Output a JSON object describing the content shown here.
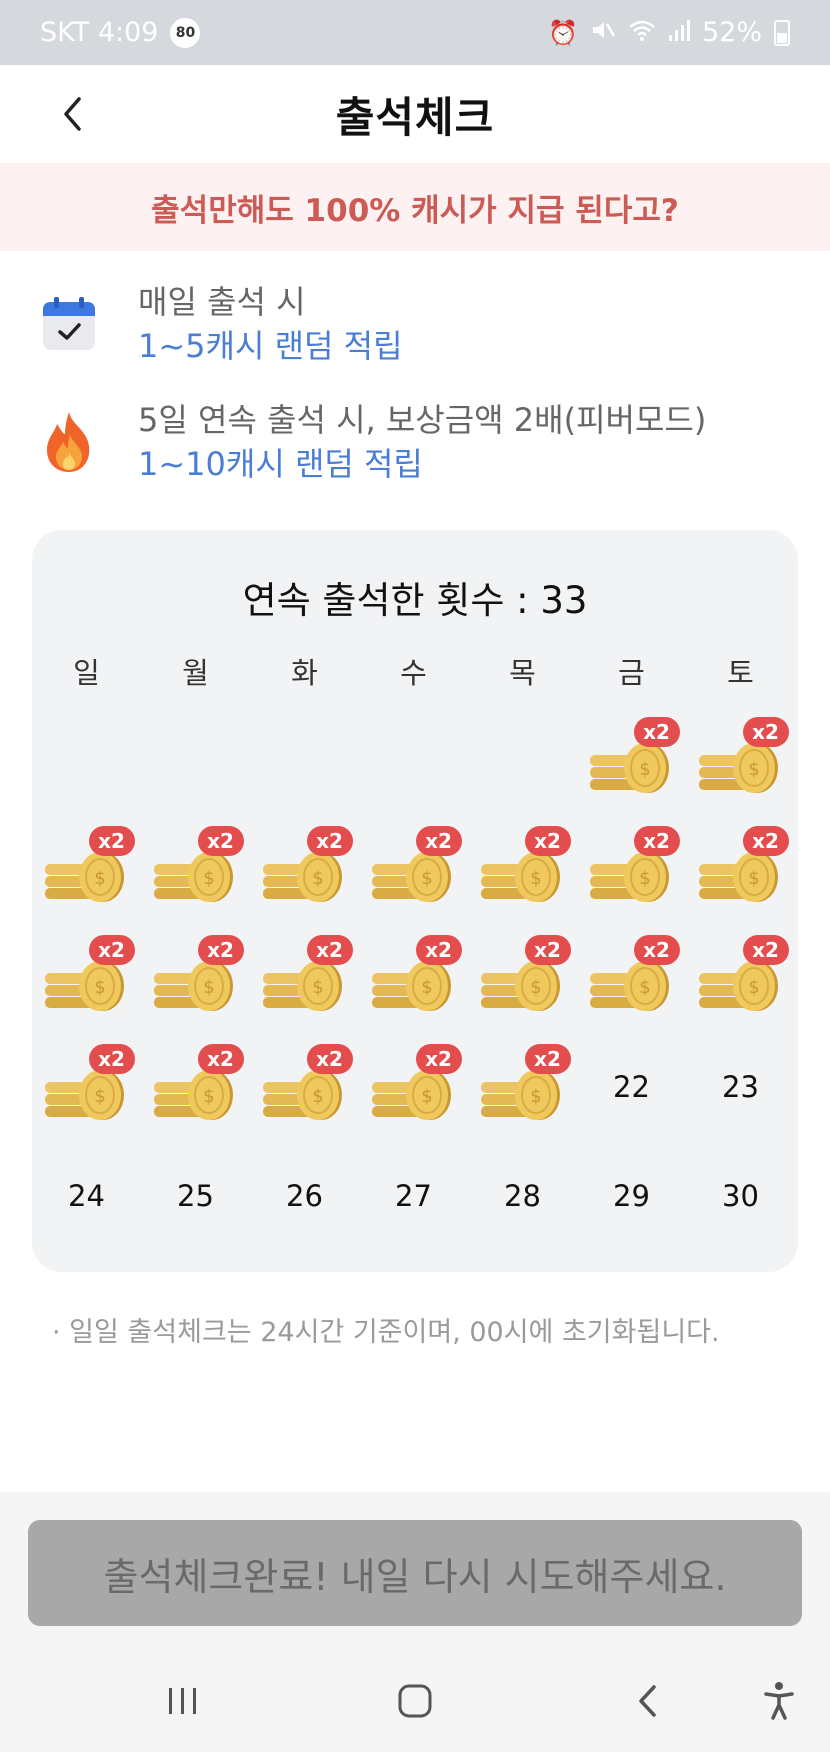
{
  "status_bar": {
    "carrier_time": "SKT 4:09",
    "badge": "80",
    "battery": "52%"
  },
  "header": {
    "title": "출석체크"
  },
  "banner": {
    "text": "출석만해도 100% 캐시가 지급 된다고?"
  },
  "rules": [
    {
      "icon": "calendar-check-icon",
      "line1": "매일 출석 시",
      "line2": "1~5캐시 랜덤 적립"
    },
    {
      "icon": "fire-icon",
      "line1": "5일 연속 출석 시, 보상금액 2배(피버모드)",
      "line2": "1~10캐시 랜덤 적립"
    }
  ],
  "calendar": {
    "title": "연속 출석한 횟수 : 33",
    "weekdays": [
      "일",
      "월",
      "화",
      "수",
      "목",
      "금",
      "토"
    ],
    "reward_badge": "x2",
    "rows": [
      [
        null,
        null,
        null,
        null,
        null,
        {
          "state": "attended"
        },
        {
          "state": "attended"
        }
      ],
      [
        {
          "state": "attended"
        },
        {
          "state": "attended"
        },
        {
          "state": "attended"
        },
        {
          "state": "attended"
        },
        {
          "state": "attended"
        },
        {
          "state": "attended"
        },
        {
          "state": "attended"
        }
      ],
      [
        {
          "state": "attended"
        },
        {
          "state": "attended"
        },
        {
          "state": "attended"
        },
        {
          "state": "attended"
        },
        {
          "state": "attended"
        },
        {
          "state": "attended"
        },
        {
          "state": "attended"
        }
      ],
      [
        {
          "state": "attended"
        },
        {
          "state": "attended"
        },
        {
          "state": "attended"
        },
        {
          "state": "attended"
        },
        {
          "state": "attended"
        },
        {
          "state": "day",
          "label": "22"
        },
        {
          "state": "day",
          "label": "23"
        }
      ],
      [
        {
          "state": "day",
          "label": "24"
        },
        {
          "state": "day",
          "label": "25"
        },
        {
          "state": "day",
          "label": "26"
        },
        {
          "state": "day",
          "label": "27"
        },
        {
          "state": "day",
          "label": "28"
        },
        {
          "state": "day",
          "label": "29"
        },
        {
          "state": "day",
          "label": "30"
        }
      ]
    ]
  },
  "notice": "· 일일 출석체크는 24시간 기준이며, 00시에 초기화됩니다.",
  "complete_button": {
    "label": "출석체크완료! 내일 다시 시도해주세요."
  },
  "colors": {
    "accent_blue": "#4a7dd4",
    "banner_red": "#cc5a55",
    "badge_red": "#e34d4d",
    "coin_gold": "#e9c15a"
  }
}
